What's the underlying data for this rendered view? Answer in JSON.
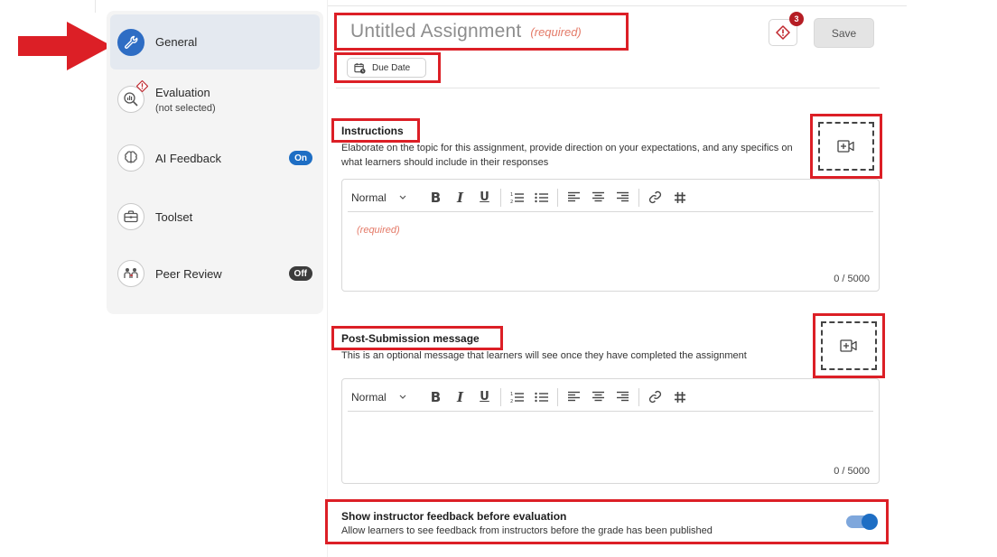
{
  "sidebar": {
    "items": [
      {
        "label": "General",
        "icon": "wrench-icon",
        "active": true
      },
      {
        "label": "Evaluation",
        "sub": "(not selected)",
        "icon": "magnify-chart-icon"
      },
      {
        "label": "AI Feedback",
        "badge": "On",
        "icon": "brain-icon"
      },
      {
        "label": "Toolset",
        "icon": "toolbox-icon"
      },
      {
        "label": "Peer Review",
        "badge": "Off",
        "icon": "peer-review-icon"
      }
    ]
  },
  "header": {
    "title_placeholder": "Untitled Assignment",
    "required_label": "(required)",
    "due_date_label": "Due Date",
    "warning_count": "3",
    "save_label": "Save"
  },
  "instructions": {
    "title": "Instructions",
    "description": "Elaborate on the topic for this assignment, provide direction on your expectations, and any specifics on what learners should include in their responses",
    "format_select": "Normal",
    "placeholder": "(required)",
    "char_count": "0 / 5000"
  },
  "post_submission": {
    "title": "Post-Submission message",
    "description": "This is an optional message that learners will see once they have completed the assignment",
    "format_select": "Normal",
    "char_count": "0 / 5000"
  },
  "feedback_toggle": {
    "title": "Show instructor feedback before evaluation",
    "description": "Allow learners to see feedback from instructors before the grade has been published",
    "enabled": true
  },
  "colors": {
    "accent": "#1e6ec4",
    "annotation_red": "#dc1f26",
    "required_text": "#e47a68",
    "warning_badge": "#b51d24"
  }
}
